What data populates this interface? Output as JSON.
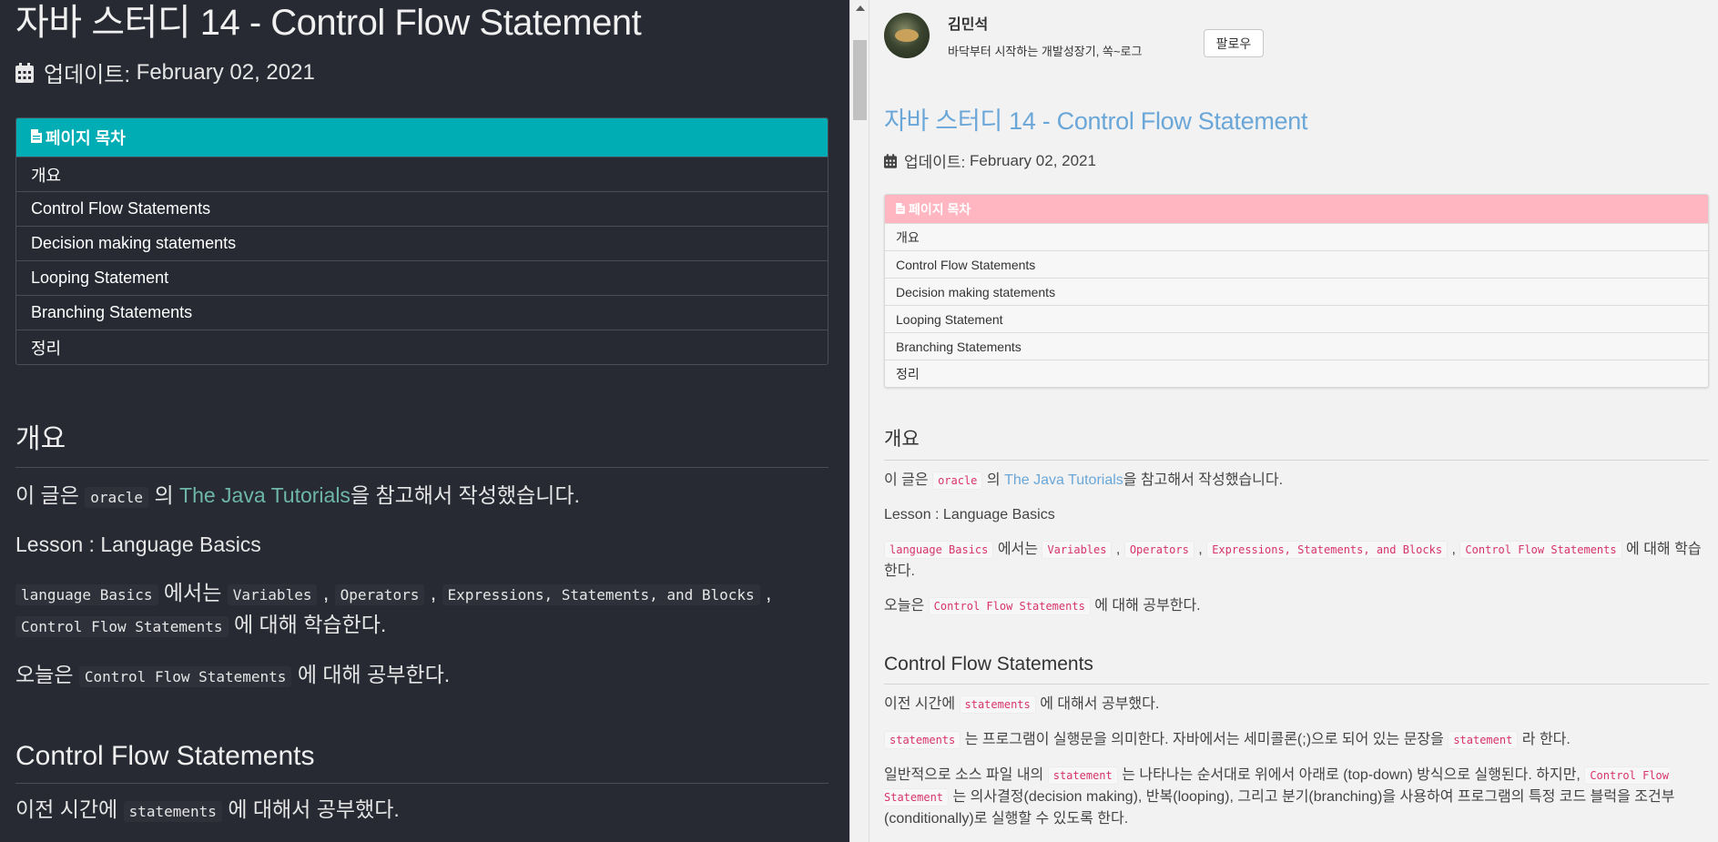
{
  "post": {
    "title": "자바 스터디 14 - Control Flow Statement",
    "updated_label": "업데이트:",
    "updated_date": "February 02, 2021"
  },
  "toc": {
    "heading": "페이지 목차",
    "items": [
      "개요",
      "Control Flow Statements",
      "Decision making statements",
      "Looping Statement",
      "Branching Statements",
      "정리"
    ]
  },
  "sections": {
    "overview": {
      "heading": "개요",
      "p1_prefix": "이 글은",
      "p1_code": "oracle",
      "p1_mid": "의",
      "p1_link": "The Java Tutorials",
      "p1_suffix": "을 참고해서 작성했습니다.",
      "p2": "Lesson : Language Basics",
      "p3_code1": "language Basics",
      "p3_text1": "에서는",
      "p3_code2": "Variables",
      "p3_code3": "Operators",
      "p3_code4": "Expressions, Statements, and Blocks",
      "p3_code5": "Control Flow Statements",
      "p3_suffix": "에 대해 학습한다.",
      "p4_prefix": "오늘은",
      "p4_code": "Control Flow Statements",
      "p4_suffix": "에 대해 공부한다."
    },
    "control_flow": {
      "heading": "Control Flow Statements",
      "p1_prefix": "이전 시간에",
      "p1_code": "statements",
      "p1_suffix": "에 대해서 공부했다.",
      "p2_code": "statements",
      "p2_text": "는 프로그램이 실행문을 의미한다. 자바에서는 세미콜론(;)으로 되어 있는 문장을",
      "p2_code2": "statement",
      "p2_suffix": "라 한다.",
      "p3_prefix": "일반적으로 소스 파일 내의",
      "p3_code": "statement",
      "p3_text": "는 나타나는 순서대로 위에서 아래로 (top-down) 방식으로 실행된다. 하지만,",
      "p3_code2": "Control Flow Statement",
      "p3_suffix": "는 의사결정(decision making), 반복(looping), 그리고 분기(branching)을 사용하여 프로그램의 특정 코드 블럭을 조건부(conditionally)로 실행할 수 있도록 한다."
    }
  },
  "profile": {
    "name": "김민석",
    "bio": "바닥부터 시작하는 개발성장기, 쏙~로그",
    "follow_label": "팔로우"
  },
  "icons": {
    "calendar": "calendar-icon",
    "document": "document-icon"
  },
  "colors": {
    "dark_bg": "#272a33",
    "dark_toc_header": "#00adb5",
    "dark_link": "#6db6a8",
    "light_bg": "#f2f2f2",
    "light_toc_header": "#ffb6c1",
    "light_title": "#6aa7d8",
    "light_code": "#d6336c"
  }
}
